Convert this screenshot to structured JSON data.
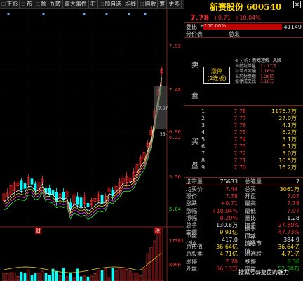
{
  "toolbar": {
    "items": [
      "下影",
      "布",
      "颓",
      "九转",
      "重大事件",
      "右",
      "加自选",
      "均线",
      "购收",
      "筹",
      "更多"
    ],
    "arrow_left": "◀",
    "arrow_right": "▶"
  },
  "axis": {
    "labels": [
      "7.99",
      "7.48",
      "6.96",
      "6.22",
      "5.56",
      "5.04"
    ],
    "volume_labels": [
      "17381",
      "8690"
    ],
    "markers": [
      "7.07",
      "55-"
    ],
    "event_marks": [
      "财",
      "税"
    ]
  },
  "stock": {
    "title": "新赛股份 600540",
    "price": "7.78",
    "change": "+0.71",
    "pct": "+10.04%"
  },
  "weibi": {
    "label": "委比",
    "value": "+100.00%",
    "count": "41149"
  },
  "fenjia": {
    "label": "分价表",
    "total": "-总来"
  },
  "sell": {
    "label1": "卖",
    "label2": "盘",
    "limit_line1": "涨停",
    "limit_line2": "(2连板)",
    "analysis_title": "分析：",
    "analysis_title2": "新熄理解+风险",
    "analysis": [
      [
        "当前封单量：",
        "11.17万"
      ],
      [
        "封单占流通：",
        "1.16%"
      ],
      [
        "当前封单额：",
        "1.29亿"
      ],
      [
        "振停成交比：",
        "3.16万"
      ]
    ]
  },
  "buy": {
    "label1": "买",
    "label2": "盘",
    "rows": [
      [
        "1",
        "7.78",
        "1176.7万"
      ],
      [
        "2",
        "7.77",
        "27.0万"
      ],
      [
        "3",
        "7.76",
        "4.1万"
      ],
      [
        "4",
        "7.75",
        "6.2万"
      ],
      [
        "5",
        "7.74",
        "5.1万"
      ],
      [
        "6",
        "7.73",
        "6.1万"
      ],
      [
        "7",
        "7.72",
        "5.0万"
      ],
      [
        "8",
        "7.71",
        "10.5万"
      ],
      [
        "9",
        "7.70",
        "16.2万"
      ]
    ]
  },
  "summary": {
    "rows": [
      [
        "均买价",
        "7.44",
        "总买",
        "3061万"
      ],
      [
        "现价",
        "7.78",
        "开盘",
        "7.07"
      ],
      [
        "涨跌",
        "+0.71",
        "最高",
        "7.78"
      ],
      [
        "涨幅",
        "+10.04%",
        "最低",
        "7.07"
      ],
      [
        "振幅",
        "8.20%",
        "量比",
        "1.28"
      ],
      [
        "总手",
        "130.8万",
        "换手",
        "27.60%"
      ],
      [
        "金额",
        "9.91亿",
        "换手(实)",
        "47.73%"
      ],
      [
        "市盈(动)",
        "417.0",
        "市盈(静)",
        "384.9"
      ],
      [
        "总市值",
        "36.64亿",
        "流通市值",
        "36.64亿"
      ],
      [
        "总股本",
        "4.71亿",
        "流通股",
        "4.71亿"
      ],
      [
        "涨停",
        "7.78",
        "跌停",
        "6.36"
      ],
      [
        "外盘",
        "56.13万",
        "内盘",
        "52.50万"
      ]
    ],
    "colors": [
      [
        "red",
        "yellow"
      ],
      [
        "red",
        "red"
      ],
      [
        "red",
        "red"
      ],
      [
        "red",
        "red"
      ],
      [
        "red",
        "white"
      ],
      [
        "white",
        "red"
      ],
      [
        "yellow",
        "red"
      ],
      [
        "white",
        "white"
      ],
      [
        "yellow",
        "yellow"
      ],
      [
        "yellow",
        "yellow"
      ],
      [
        "red",
        "green"
      ],
      [
        "red",
        "green"
      ]
    ]
  },
  "vol_header": {
    "label": "选带量",
    "value": "75633",
    "label2": "总笔量",
    "value2": "7"
  },
  "watermark": "搜狐号@复盘的魅力",
  "colors": {
    "up": "#ff3030",
    "down": "#00ffff",
    "accent": "#ffd700"
  }
}
